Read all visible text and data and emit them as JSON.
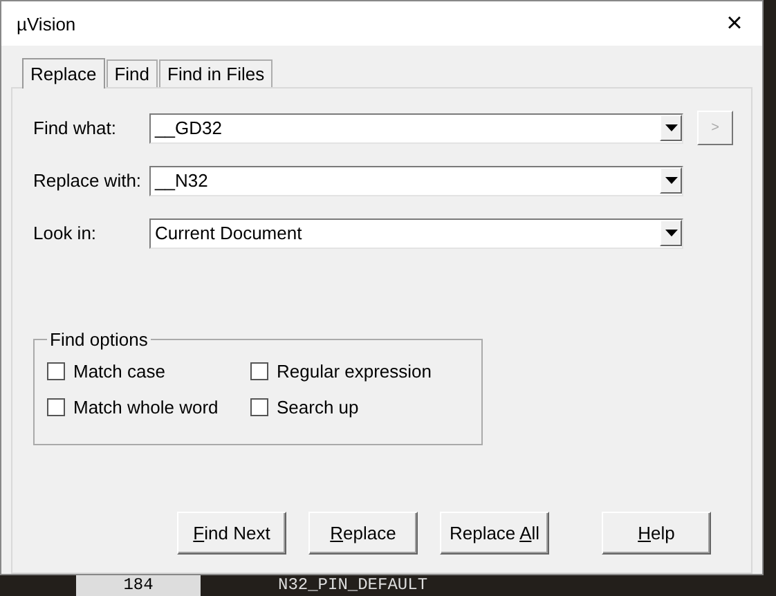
{
  "window": {
    "title": "µVision",
    "close": "×"
  },
  "tabs": [
    {
      "label": "Replace",
      "selected": true
    },
    {
      "label": "Find",
      "selected": false
    },
    {
      "label": "Find in Files",
      "selected": false
    }
  ],
  "fields": [
    {
      "label": "Find what:",
      "value": "__GD32",
      "extra_button": ">"
    },
    {
      "label": "Replace with:",
      "value": "__N32"
    },
    {
      "label": "Look in:",
      "value": "Current Document"
    }
  ],
  "find_options": {
    "title": "Find options",
    "options": [
      {
        "label": "Match case",
        "checked": false
      },
      {
        "label": "Regular expression",
        "checked": false
      },
      {
        "label": "Match whole word",
        "checked": false
      },
      {
        "label": "Search up",
        "checked": false
      }
    ]
  },
  "buttons": [
    {
      "access_key": "F",
      "after": "ind Next"
    },
    {
      "access_key": "R",
      "after": "eplace"
    },
    {
      "before": "Replace ",
      "access_key": "A",
      "after": "ll"
    },
    {
      "access_key": "H",
      "after": "elp"
    }
  ],
  "background_editor": {
    "line_number": "184",
    "code": "N32_PIN_DEFAULT"
  }
}
